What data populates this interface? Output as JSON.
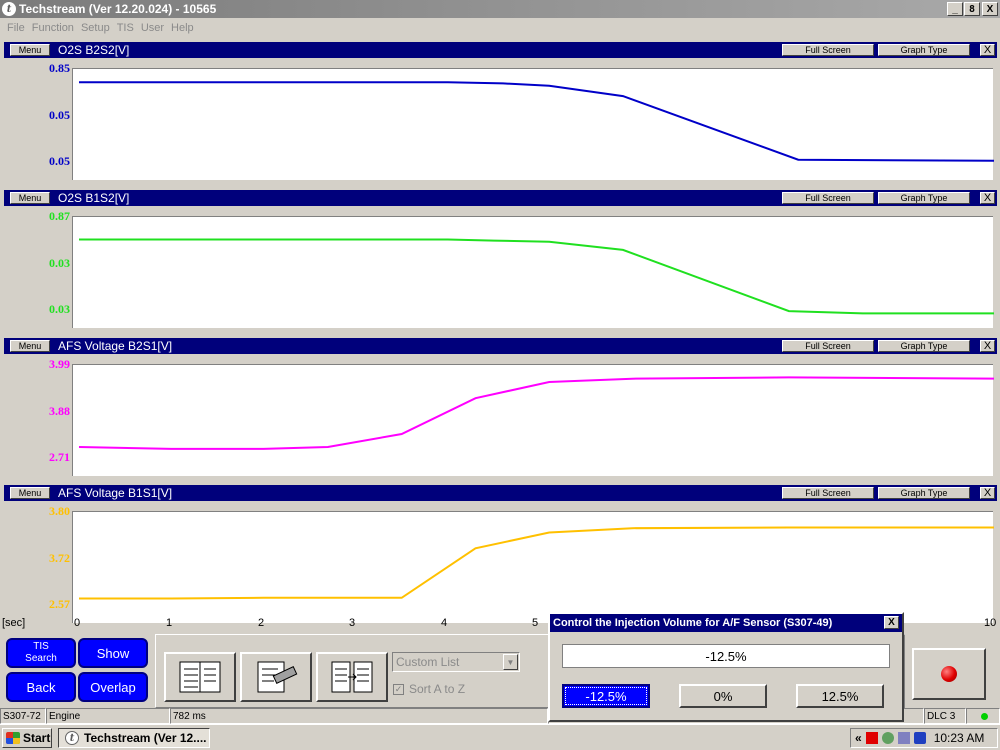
{
  "window": {
    "title": "Techstream (Ver 12.20.024) - 10565",
    "app_icon": "t",
    "minimize": "_",
    "restore": "8",
    "close": "X"
  },
  "menubar": [
    "File",
    "Function",
    "Setup",
    "TIS",
    "User",
    "Help"
  ],
  "panel_buttons": {
    "menu": "Menu",
    "full_screen": "Full Screen",
    "graph_type": "Graph Type",
    "close": "X"
  },
  "graphs": [
    {
      "title": "O2S B2S2[V]",
      "color": "#0000c8",
      "y_labels": [
        "0.85",
        "0.05",
        "0.05"
      ]
    },
    {
      "title": "O2S B1S2[V]",
      "color": "#20e020",
      "y_labels": [
        "0.87",
        "0.03",
        "0.03"
      ]
    },
    {
      "title": "AFS Voltage B2S1[V]",
      "color": "#ff00ff",
      "y_labels": [
        "3.99",
        "3.88",
        "2.71"
      ]
    },
    {
      "title": "AFS Voltage B1S1[V]",
      "color": "#ffc000",
      "y_labels": [
        "3.80",
        "3.72",
        "2.57"
      ]
    }
  ],
  "chart_data": [
    {
      "type": "line",
      "title": "O2S B2S2[V]",
      "x": [
        0,
        1,
        2,
        3,
        4,
        4.6,
        5.1,
        5.9,
        7.8,
        10
      ],
      "y": [
        0.82,
        0.82,
        0.82,
        0.82,
        0.82,
        0.81,
        0.79,
        0.7,
        0.15,
        0.14
      ],
      "ylim": [
        0,
        0.9
      ]
    },
    {
      "type": "line",
      "title": "O2S B1S2[V]",
      "x": [
        0,
        1,
        2,
        3,
        4,
        4.5,
        5.1,
        5.9,
        7.7,
        8.5,
        10
      ],
      "y": [
        0.74,
        0.74,
        0.74,
        0.74,
        0.74,
        0.73,
        0.72,
        0.65,
        0.12,
        0.1,
        0.1
      ],
      "ylim": [
        0,
        0.9
      ]
    },
    {
      "type": "line",
      "title": "AFS Voltage B2S1[V]",
      "x": [
        0,
        1,
        2,
        2.7,
        3.5,
        4.3,
        5.1,
        6,
        7.7,
        10
      ],
      "y": [
        2.9,
        2.87,
        2.87,
        2.9,
        3.1,
        3.65,
        3.9,
        3.95,
        3.97,
        3.95
      ],
      "ylim": [
        2.5,
        4.1
      ]
    },
    {
      "type": "line",
      "title": "AFS Voltage B1S1[V]",
      "x": [
        0,
        1,
        2,
        3,
        3.5,
        4.3,
        5.1,
        6,
        7.7,
        10
      ],
      "y": [
        2.7,
        2.7,
        2.71,
        2.71,
        2.71,
        3.4,
        3.62,
        3.68,
        3.69,
        3.69
      ],
      "ylim": [
        2.4,
        3.85
      ]
    }
  ],
  "xaxis": {
    "label": "[sec]",
    "ticks": [
      "0",
      "1",
      "2",
      "3",
      "4",
      "5",
      "10"
    ],
    "tick_values": [
      0,
      1,
      2,
      3,
      4,
      5,
      10
    ]
  },
  "toolbar": {
    "tis_search": "TIS Search",
    "show": "Show",
    "back": "Back",
    "overlap": "Overlap",
    "custom_list": "Custom List",
    "sort_a_to_z": "Sort A to Z"
  },
  "statusbar": {
    "code": "S307-72",
    "system": "Engine",
    "timing": "782 ms",
    "connection": "DLC 3"
  },
  "dialog": {
    "title": "Control the Injection Volume for A/F Sensor (S307-49)",
    "close": "X",
    "current_value": "-12.5%",
    "buttons": [
      "-12.5%",
      "0%",
      "12.5%"
    ],
    "selected_index": 0
  },
  "taskbar": {
    "start": "Start",
    "task": "Techstream (Ver 12....",
    "clock": "10:23 AM",
    "chevron": "«"
  }
}
